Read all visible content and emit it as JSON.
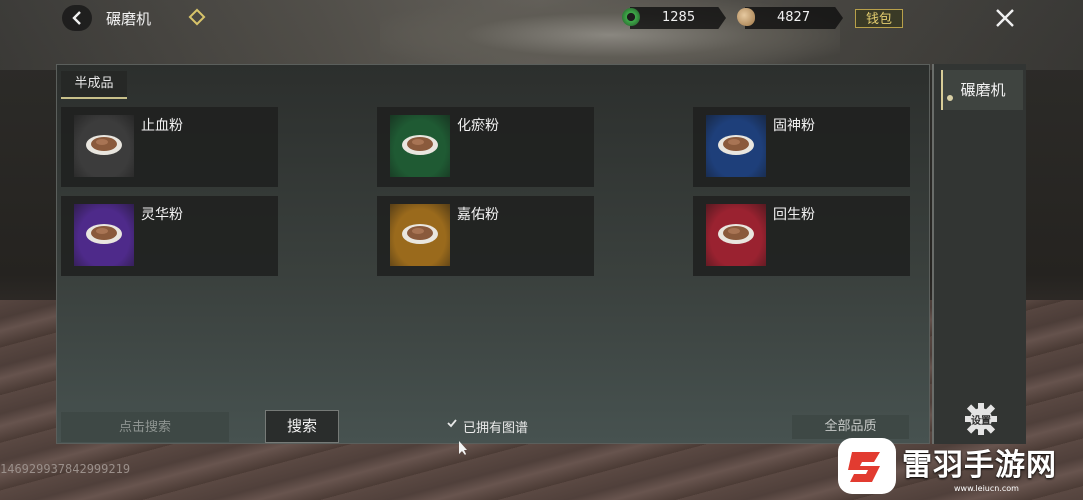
{
  "header": {
    "title": "碾磨机",
    "jade_amount": "1285",
    "coin_amount": "4827",
    "wallet_label": "钱包",
    "icons": [
      "back-arrow-icon",
      "diamond-icon",
      "jade-coin-icon",
      "copper-coin-icon",
      "close-icon"
    ]
  },
  "tabs": {
    "semi_products": "半成品"
  },
  "items": [
    {
      "name": "止血粉",
      "color": "#3c3c3c"
    },
    {
      "name": "化瘀粉",
      "color": "#1f5a33"
    },
    {
      "name": "固神粉",
      "color": "#1e3f7a"
    },
    {
      "name": "灵华粉",
      "color": "#4e2a8a"
    },
    {
      "name": "嘉佑粉",
      "color": "#9a6a1c"
    },
    {
      "name": "回生粉",
      "color": "#9a2230"
    }
  ],
  "bottom": {
    "search_placeholder": "点击搜索",
    "search_button": "搜索",
    "owned_label": "已拥有图谱",
    "quality_select": "全部品质"
  },
  "side": {
    "grinder_tab": "碾磨机",
    "gear_label": "设置"
  },
  "uid": "1469299378429992​19",
  "watermark": {
    "brand": "雷羽手游网",
    "url": "www.leiucn.com"
  }
}
